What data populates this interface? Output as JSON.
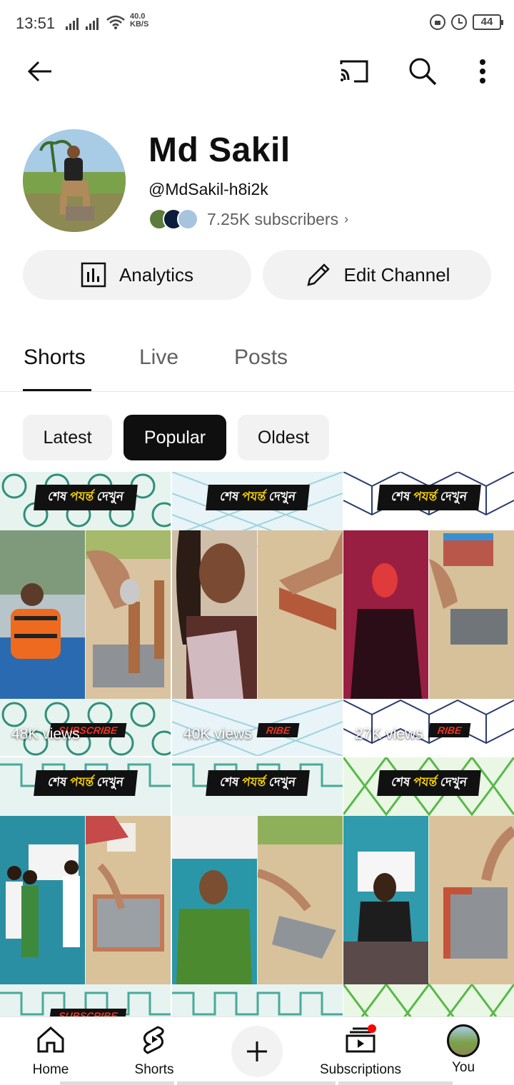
{
  "status_bar": {
    "time": "13:51",
    "net_speed_value": "40.0",
    "net_speed_unit": "KB/S",
    "battery": "44"
  },
  "top_bar": {
    "back_icon": "arrow-left-icon",
    "cast_icon": "cast-icon",
    "search_icon": "search-icon",
    "more_icon": "more-vert-icon"
  },
  "channel": {
    "name": "Md Sakil",
    "handle": "@MdSakil-h8i2k",
    "subscribers": "7.25K subscribers",
    "analytics_label": "Analytics",
    "edit_label": "Edit Channel"
  },
  "tabs": [
    {
      "label": "Shorts",
      "active": true
    },
    {
      "label": "Live",
      "active": false
    },
    {
      "label": "Posts",
      "active": false
    }
  ],
  "chips": [
    {
      "label": "Latest",
      "active": false
    },
    {
      "label": "Popular",
      "active": true
    },
    {
      "label": "Oldest",
      "active": false
    }
  ],
  "shorts": [
    {
      "banner_a": "শেষ ",
      "banner_b": "পযর্ন্ত",
      "banner_c": " দেখুন",
      "views": "48K views",
      "tag": "SUBSCRIBE"
    },
    {
      "banner_a": "শেষ ",
      "banner_b": "পযর্ন্ত",
      "banner_c": " দেখুন",
      "views": "40K views",
      "tag": "RIBE"
    },
    {
      "banner_a": "শেষ ",
      "banner_b": "পযর্ন্ত",
      "banner_c": " দেখুন",
      "views": "27K views",
      "tag": "RIBE"
    },
    {
      "banner_a": "শেষ ",
      "banner_b": "পযর্ন্ত",
      "banner_c": " দেখুন",
      "views": "",
      "tag": "SUBSCRIBE"
    },
    {
      "banner_a": "শেষ ",
      "banner_b": "পযর্ন্ত",
      "banner_c": " দেখুন",
      "views": "",
      "tag": ""
    },
    {
      "banner_a": "শেষ ",
      "banner_b": "পযর্ন্ত",
      "banner_c": " দেখুন",
      "views": "",
      "tag": ""
    }
  ],
  "bottom_nav": {
    "home": "Home",
    "shorts": "Shorts",
    "subscriptions": "Subscriptions",
    "you": "You"
  },
  "colors": {
    "accent_red": "#ff0000",
    "chip_bg": "#f2f2f2",
    "active_chip": "#0f0f0f",
    "secondary_text": "#606060"
  }
}
